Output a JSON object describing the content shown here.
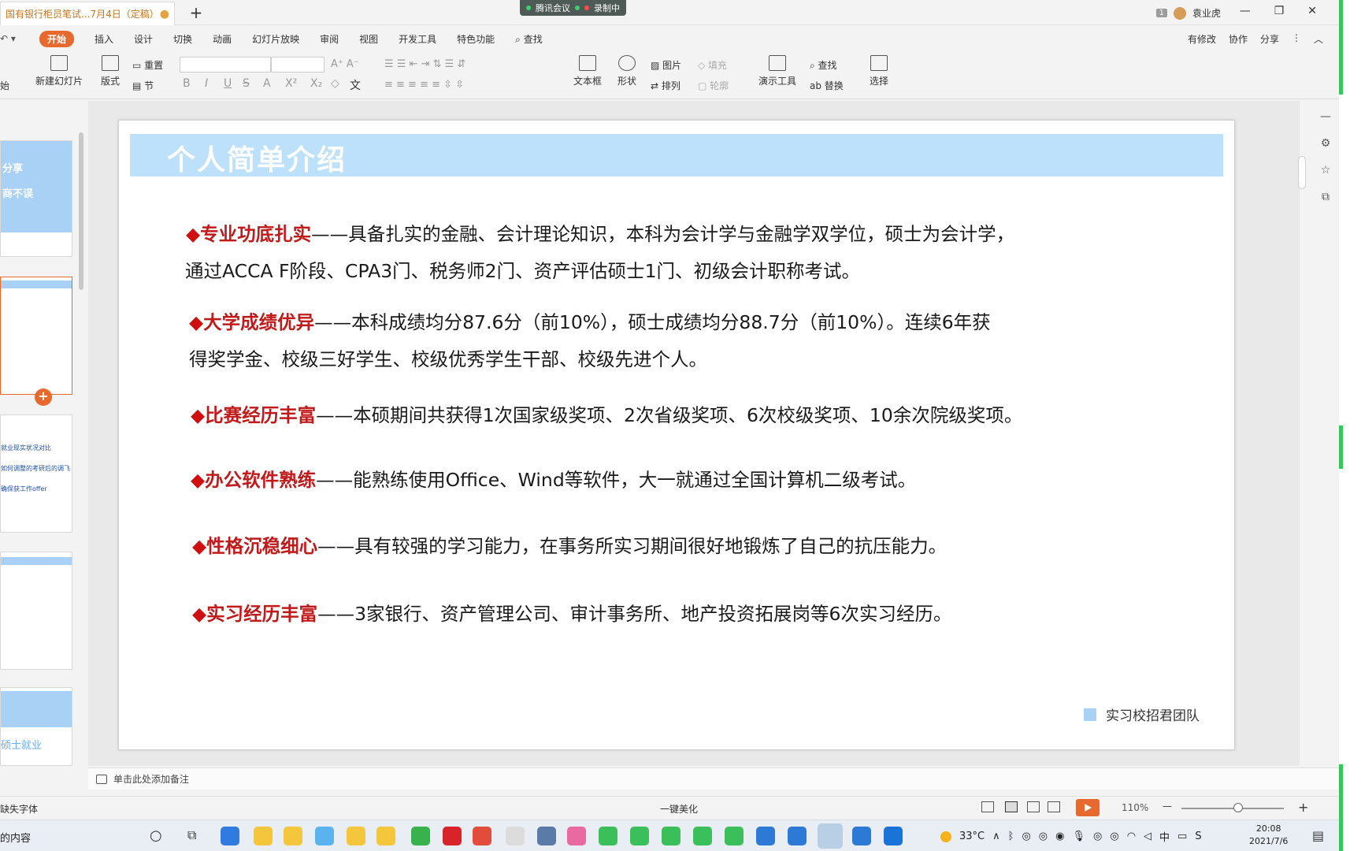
{
  "window": {
    "doc_tab_title": "国有银行柜员笔试...7月4日（定稿）",
    "doc_tab_modified": "●",
    "new_tab": "+",
    "meeting": {
      "app": "腾讯会议",
      "recording": "录制中"
    },
    "user_badge": "1",
    "user_name": "袁业虎",
    "controls": {
      "minimize": "—",
      "restore": "❐",
      "close": "✕"
    }
  },
  "menubar": {
    "left_tools": "↶ ▾",
    "items": [
      "开始",
      "插入",
      "设计",
      "切换",
      "动画",
      "幻灯片放映",
      "审阅",
      "视图",
      "开发工具",
      "特色功能",
      "查找"
    ],
    "right": {
      "changes": "有修改",
      "collab": "协作",
      "share": "分享"
    }
  },
  "ribbon": {
    "cut_label": "始",
    "new_slide": "新建幻灯片",
    "layout": "版式",
    "reset": "重置",
    "section": "节",
    "font_name": "",
    "font_size": "",
    "textbox": "文本框",
    "shape": "形状",
    "picture": "图片",
    "fill": "填充",
    "arrange": "排列",
    "outline": "轮廓",
    "present_tool": "演示工具",
    "find": "查找",
    "replace": "替换",
    "select": "选择",
    "format_buttons": [
      "B",
      "I",
      "U",
      "S",
      "A",
      "X²",
      "X₂",
      "◇",
      "文"
    ]
  },
  "thumbs": {
    "t1_line1": "分享",
    "t1_line2": "商不误",
    "t3_line1": "就业现实状况对比",
    "t3_line2": "如何调整的考研后的调飞",
    "t3_line3": "确保获工作offer",
    "t5_text": "硕士就业",
    "add": "+"
  },
  "slide": {
    "title": "个人简单介绍",
    "bullets": [
      {
        "diamond": "◆",
        "key": "专业功底扎实",
        "rest": "——具备扎实的金融、会计理论知识，本科为会计学与金融学双学位，硕士为会计学，",
        "line2": "通过ACCA F阶段、CPA3门、税务师2门、资产评估硕士1门、初级会计职称考试。"
      },
      {
        "diamond": "◆",
        "key": "大学成绩优异",
        "rest": "——本科成绩均分87.6分（前10%），硕士成绩均分88.7分（前10%）。连续6年获",
        "line2": "得奖学金、校级三好学生、校级优秀学生干部、校级先进个人。"
      },
      {
        "diamond": "◆",
        "key": "比赛经历丰富",
        "rest": "——本硕期间共获得1次国家级奖项、2次省级奖项、6次校级奖项、10余次院级奖项。",
        "line2": ""
      },
      {
        "diamond": "◆",
        "key": "办公软件熟练",
        "rest": "——能熟练使用Office、Wind等软件，大一就通过全国计算机二级考试。",
        "line2": ""
      },
      {
        "diamond": "◆",
        "key": "性格沉稳细心",
        "rest": "——具有较强的学习能力，在事务所实习期间很好地锻炼了自己的抗压能力。",
        "line2": ""
      },
      {
        "diamond": "◆",
        "key": "实习经历丰富",
        "rest": "——3家银行、资产管理公司、审计事务所、地产投资拓展岗等6次实习经历。",
        "line2": ""
      }
    ],
    "footer": "实习校招君团队"
  },
  "notes": {
    "placeholder": "单击此处添加备注"
  },
  "status": {
    "missing_font": "缺失字体",
    "beautify": "一键美化",
    "zoom": "110%",
    "zoom_minus": "—",
    "zoom_plus": "+"
  },
  "taskbar": {
    "search_text": "的内容",
    "weather": "33°C",
    "ime": "中",
    "time": "20:08",
    "date": "2021/7/6"
  }
}
